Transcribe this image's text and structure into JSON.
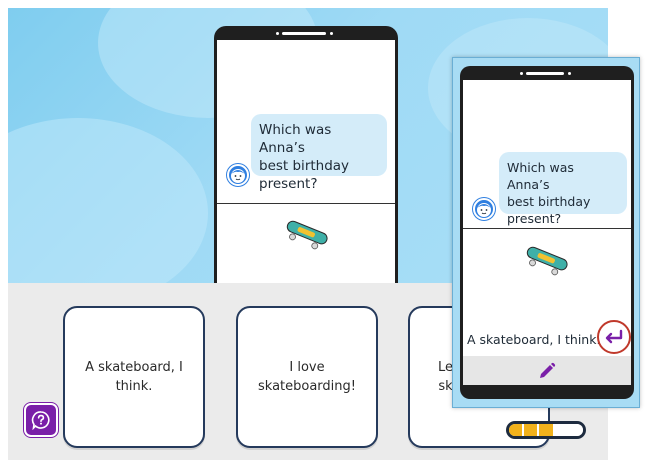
{
  "question": {
    "text_line1": "Which was Anna’s",
    "text_line2": "best birthday",
    "text_line3": "present?"
  },
  "answers": [
    {
      "line1": "A skateboard, I",
      "line2": "think."
    },
    {
      "line1": "I love",
      "line2": "skateboarding!"
    },
    {
      "line1": "Le",
      "line2": "sk"
    }
  ],
  "zoom": {
    "question_line1": "Which was Anna’s",
    "question_line2": "best birthday",
    "question_line3": "present?",
    "typed_answer": "A skateboard, I think."
  },
  "progress": {
    "filled_segments": 3,
    "total_segments": 5
  },
  "icons": {
    "help": "help-bubble-icon",
    "avatar": "boy-avatar-icon",
    "skateboard": "skateboard-icon",
    "enter": "enter-return-icon",
    "edit": "pencil-icon"
  },
  "colors": {
    "accent_purple": "#7a1fa8",
    "card_border": "#253a5c",
    "progress_fill": "#f2b21c",
    "enter_ring": "#c0392b",
    "bubble": "#d4ecf9"
  }
}
